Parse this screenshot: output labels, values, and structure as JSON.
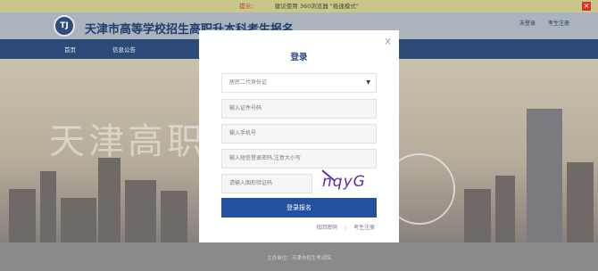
{
  "notice": {
    "tip_label": "提示：",
    "message": "建议使用 360浏览器 \"极速模式\"",
    "close_icon": "close-icon"
  },
  "header": {
    "site_title": "天津市高等学校招生高职升本科考生报名",
    "logo_text": "TJ",
    "not_logged_in": "未登录",
    "register": "考生注册"
  },
  "nav": {
    "items": [
      "首页",
      "信息公告"
    ]
  },
  "banner": {
    "text": "天津高职"
  },
  "footer": {
    "text": "主办单位：天津市招生考试院"
  },
  "modal": {
    "title": "登录",
    "close": "X",
    "id_type_select": "居民二代身份证",
    "id_number_placeholder": "输入证件号码",
    "phone_placeholder": "输入手机号",
    "password_placeholder": "输入短信登录密码,注意大小写",
    "captcha_placeholder": "请输入图形验证码",
    "captcha_text": "nqyG",
    "login_button": "登录报名",
    "forgot_password": "找回密码",
    "separator": "|",
    "register_link": "考生注册"
  },
  "colors": {
    "nav_bg": "#2c4a78",
    "primary_button": "#2350a0",
    "captcha": "#5b2fa3",
    "notice_bg": "#c9c68b"
  }
}
